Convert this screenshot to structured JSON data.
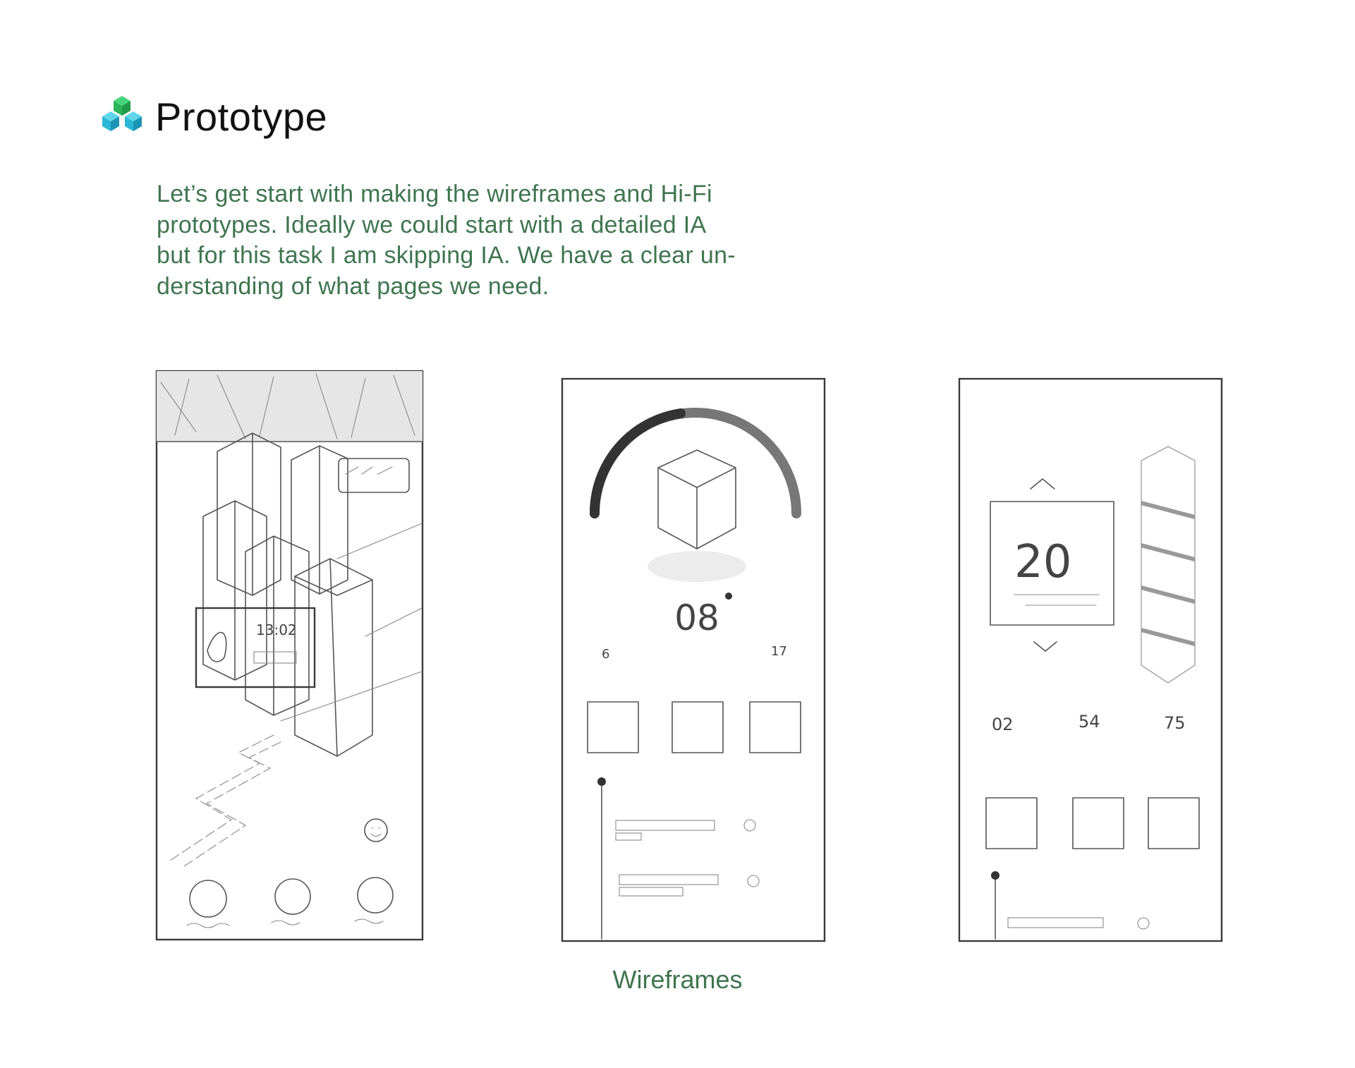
{
  "header": {
    "title": "Prototype",
    "logo_icon": "stacked-cubes-icon",
    "logo_colors": [
      "#2ecc71",
      "#29b6d4",
      "#1fa3c9"
    ]
  },
  "intro": {
    "lines": [
      "Let’s get start with making the wireframes and Hi-Fi",
      "prototypes. Ideally we could start with a detailed IA",
      "but for this task I am skipping IA. We have a clear un-",
      "derstanding of what pages we need."
    ]
  },
  "sketches": {
    "map_screen": {
      "time": "13:02"
    },
    "timer_screen": {
      "value": "08",
      "min": "6",
      "max": "17"
    },
    "detail_screen": {
      "value": "20",
      "stats": [
        "02",
        "54",
        "75"
      ]
    }
  },
  "caption": "Wireframes",
  "colors": {
    "text_green": "#3f7550",
    "title": "#111111"
  }
}
